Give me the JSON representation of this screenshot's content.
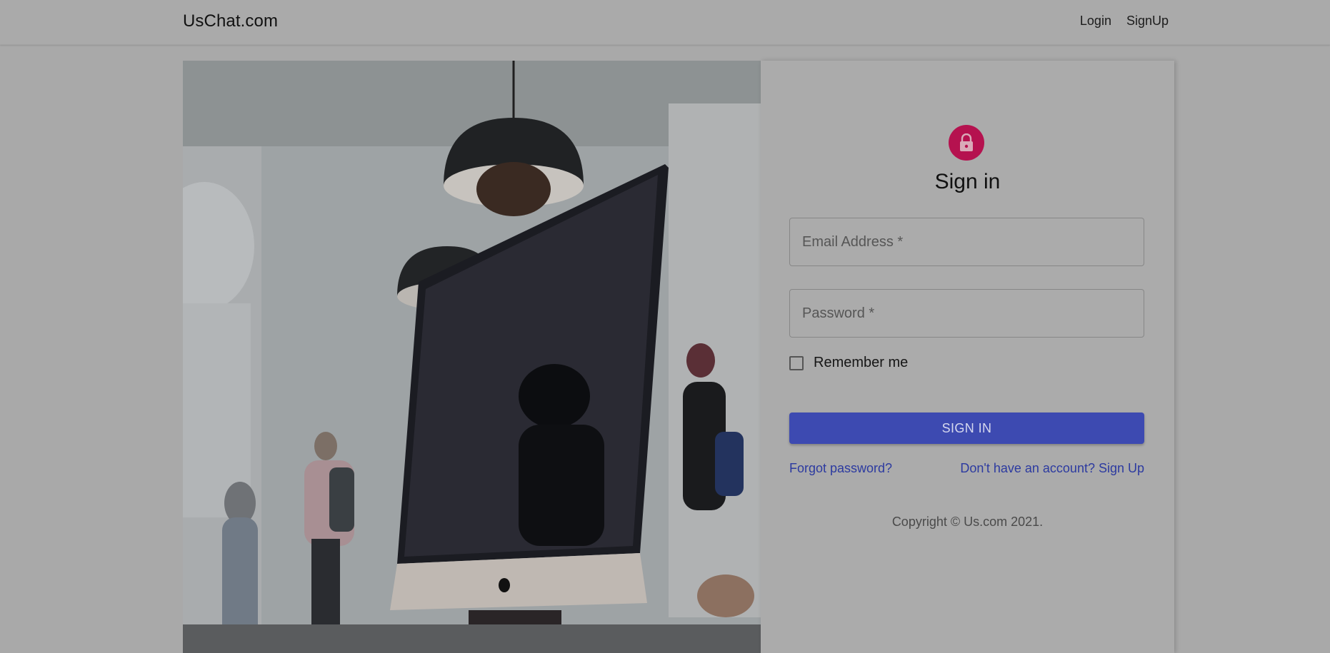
{
  "header": {
    "brand": "UsChat.com",
    "nav": {
      "login": "Login",
      "signup": "SignUp"
    }
  },
  "hero": {
    "icon": "computer-photo"
  },
  "form": {
    "avatar_icon": "lock-icon",
    "avatar_color": "#b5124f",
    "title": "Sign in",
    "email": {
      "placeholder": "Email Address *",
      "value": ""
    },
    "password": {
      "placeholder": "Password *",
      "value": ""
    },
    "remember_label": "Remember me",
    "remember_checked": false,
    "submit_label": "SIGN IN",
    "forgot_link": "Forgot password?",
    "signup_link": "Don't have an account? Sign Up",
    "copyright": "Copyright © Us.com 2021."
  },
  "colors": {
    "accent": "#3d4ab1",
    "link": "#2c3aa0",
    "overlay_bg": "#a9a9a9"
  }
}
